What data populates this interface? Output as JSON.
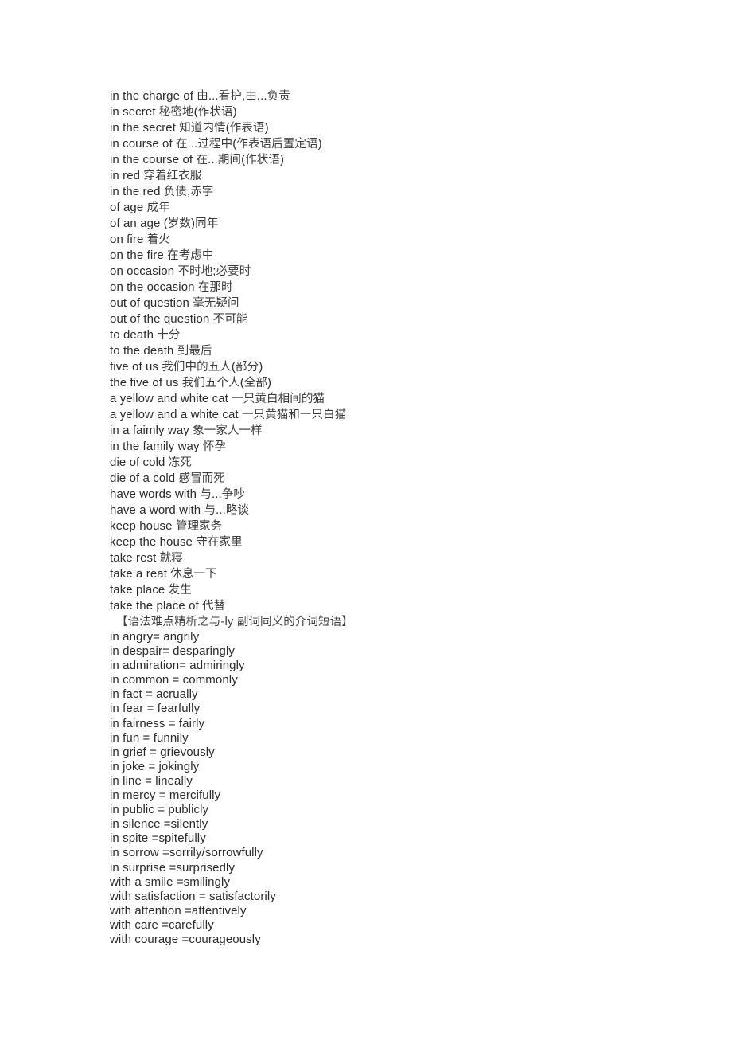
{
  "document": {
    "type": "study-notes-page",
    "background_color": "#ffffff",
    "text_color": "#2b2b2b",
    "sections": [
      {
        "id": "prepositional-phrase-pairs",
        "spacing": "normal",
        "lines": [
          "in the charge of 由...看护,由...负责",
          "in secret 秘密地(作状语)",
          "in the secret 知道内情(作表语)",
          "in course of 在...过程中(作表语后置定语)",
          "in the course of 在...期间(作状语)",
          "in red 穿着红衣服",
          "in the red 负债,赤字",
          "of age 成年",
          "of an age (岁数)同年",
          "on fire 着火",
          "on the fire 在考虑中",
          "on occasion 不时地;必要时",
          "on the occasion 在那时",
          "out of question 毫无疑问",
          "out of the question 不可能",
          "to death 十分",
          "to the death 到最后",
          "five of us 我们中的五人(部分)",
          "the five of us 我们五个人(全部)",
          "a yellow and white cat 一只黄白相间的猫",
          "a yellow and a white cat 一只黄猫和一只白猫",
          "in a faimly way 象一家人一样",
          "in the family way 怀孕",
          "die of cold 冻死",
          "die of a cold 感冒而死",
          "have words with 与...争吵",
          "have a word with 与...略谈",
          "keep house 管理家务",
          "keep the house 守在家里",
          "take rest 就寝",
          "take a reat 休息一下",
          "take place 发生",
          "take the place of 代替"
        ]
      },
      {
        "id": "ly-adverb-heading",
        "spacing": "heading",
        "lines": [
          "【语法难点精析之与-ly 副词同义的介词短语】"
        ]
      },
      {
        "id": "ly-adverb-equivalents",
        "spacing": "tight",
        "lines": [
          "in angry= angrily",
          "in despair= desparingly",
          "in admiration= admiringly",
          "in common = commonly",
          "in fact = acrually",
          "in fear = fearfully",
          "in fairness = fairly",
          "in fun = funnily",
          "in grief = grievously",
          "in joke = jokingly",
          "in line = lineally",
          "in mercy = mercifully",
          "in public = publicly",
          "in silence =silently",
          "in spite =spitefully",
          "in sorrow =sorrily/sorrowfully",
          "in surprise =surprisedly",
          "with a smile =smilingly",
          "with satisfaction = satisfactorily",
          "with attention =attentively",
          "with care =carefully",
          "with courage =courageously"
        ]
      }
    ]
  }
}
